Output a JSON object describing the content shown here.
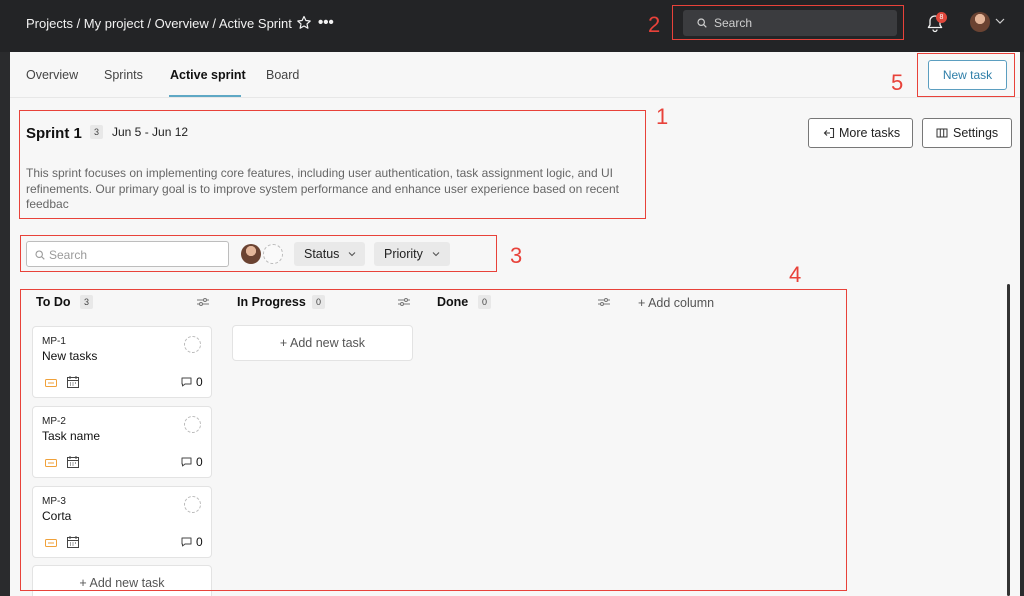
{
  "header": {
    "breadcrumb": "Projects / My project / Overview / Active Sprint",
    "search_placeholder": "Search",
    "notification_count": "8"
  },
  "tabs": [
    {
      "label": "Overview"
    },
    {
      "label": "Sprints"
    },
    {
      "label": "Active sprint"
    },
    {
      "label": "Board"
    }
  ],
  "actions": {
    "new_task": "New task",
    "more_tasks": "More tasks",
    "settings": "Settings"
  },
  "sprint": {
    "title": "Sprint 1",
    "count": "3",
    "dates": "Jun 5 - Jun 12",
    "description": "This sprint focuses on implementing core features, including user authentication, task assignment logic, and UI refinements. Our primary goal is to improve system performance and enhance user experience based on recent feedbac"
  },
  "filters": {
    "search_placeholder": "Search",
    "status_label": "Status",
    "priority_label": "Priority"
  },
  "board": {
    "columns": [
      {
        "title": "To Do",
        "count": "3"
      },
      {
        "title": "In Progress",
        "count": "0"
      },
      {
        "title": "Done",
        "count": "0"
      }
    ],
    "add_column": "+ Add column",
    "add_new_task": "+ Add new task",
    "cards": [
      {
        "id": "MP-1",
        "name": "New tasks",
        "comments": "0"
      },
      {
        "id": "MP-2",
        "name": "Task name",
        "comments": "0"
      },
      {
        "id": "MP-3",
        "name": "Corta",
        "comments": "0"
      }
    ]
  },
  "annotations": [
    "1",
    "2",
    "3",
    "4",
    "5"
  ],
  "colors": {
    "accent": "#5fa8c5",
    "annotation": "#e8423a",
    "topbar": "#232426"
  }
}
